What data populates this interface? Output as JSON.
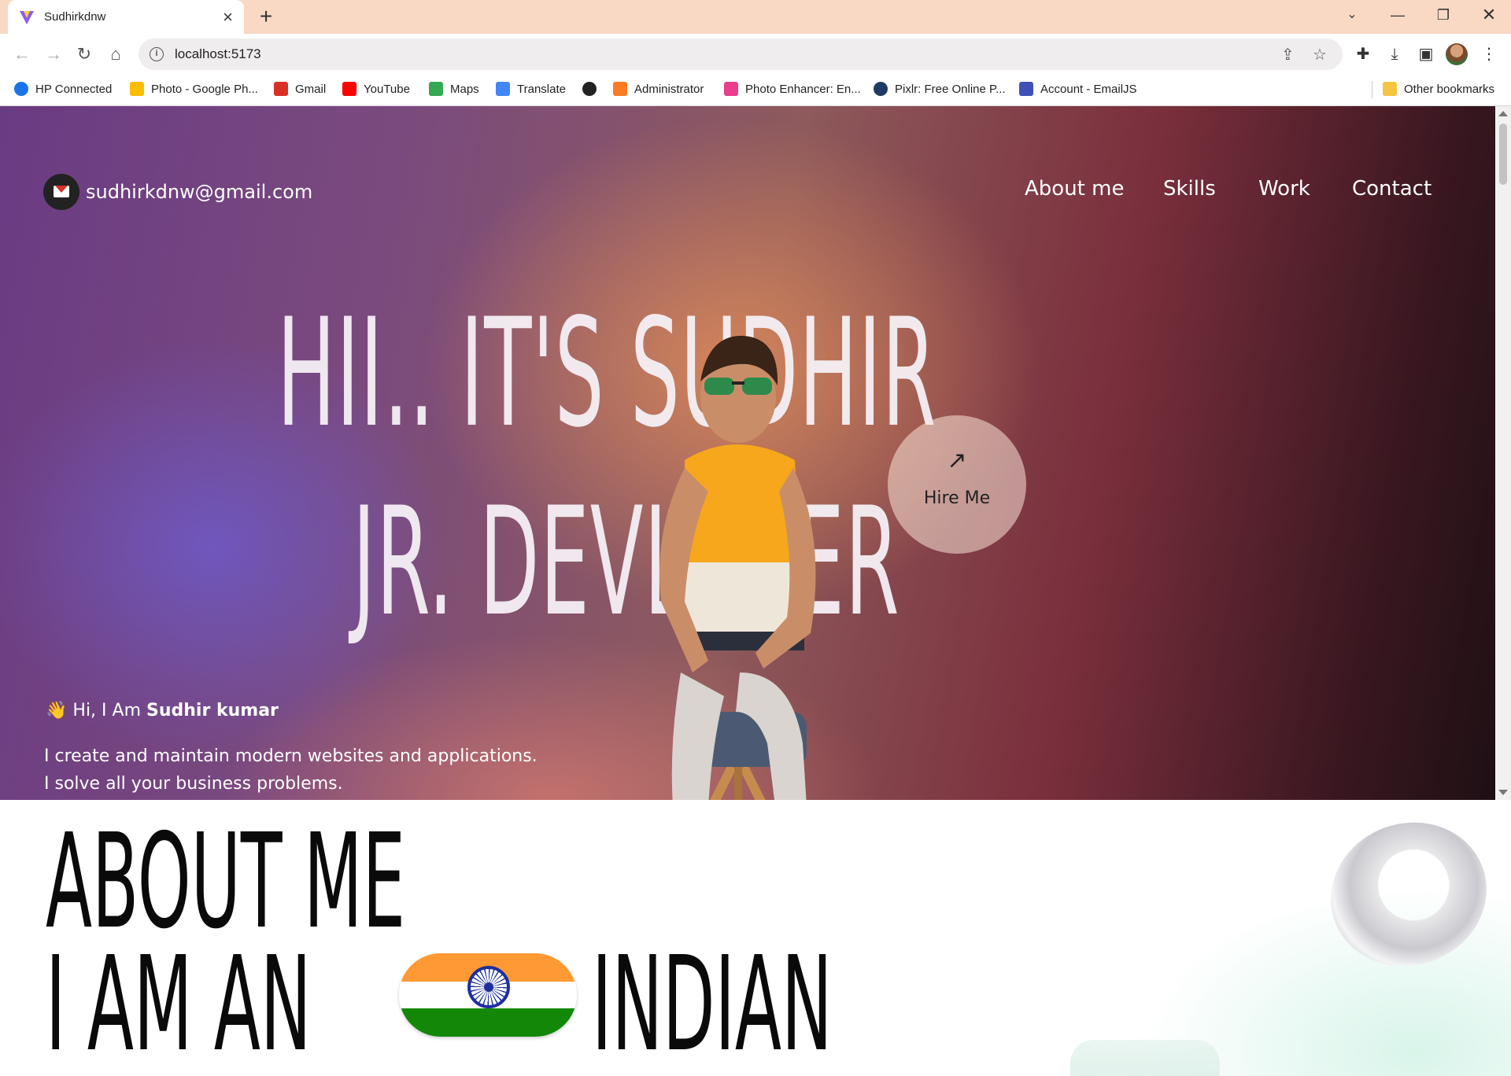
{
  "browser": {
    "tab_title": "Sudhirkdnw",
    "url": "localhost:5173",
    "bookmarks": [
      {
        "label": "HP Connected",
        "icon": "hp-icon",
        "color": "#1a73e8"
      },
      {
        "label": "Photo - Google Ph...",
        "icon": "google-photos-icon",
        "color": "#fbbc05"
      },
      {
        "label": "Gmail",
        "icon": "gmail-icon",
        "color": "#d93025"
      },
      {
        "label": "YouTube",
        "icon": "youtube-icon",
        "color": "#ff0000"
      },
      {
        "label": "Maps",
        "icon": "maps-icon",
        "color": "#34a853"
      },
      {
        "label": "Translate",
        "icon": "translate-icon",
        "color": "#4285f4"
      },
      {
        "label": "",
        "icon": "globe-icon",
        "color": "#222222"
      },
      {
        "label": "Administrator",
        "icon": "xampp-icon",
        "color": "#fb7a24"
      },
      {
        "label": "Photo Enhancer: En...",
        "icon": "photo-enhancer-icon",
        "color": "#e83e8c"
      },
      {
        "label": "Pixlr: Free Online P...",
        "icon": "pixlr-icon",
        "color": "#1f3a64"
      },
      {
        "label": "Account - EmailJS",
        "icon": "emailjs-icon",
        "color": "#3f51b5"
      }
    ],
    "other_bookmarks": "Other bookmarks"
  },
  "hero": {
    "email": "sudhirkdnw@gmail.com",
    "nav": [
      "About me",
      "Skills",
      "Work",
      "Contact"
    ],
    "headline_line1": "HII.. IT'S SUDHIR",
    "headline_line2": "JR. DEVLOPER",
    "hire_label": "Hire Me",
    "hire_arrow": "↗",
    "wave": "👋",
    "intro_prefix": "Hi, I Am",
    "intro_name": "Sudhir kumar",
    "tagline1": "I create and maintain modern websites and applications.",
    "tagline2": "I solve all your business problems."
  },
  "about": {
    "title": "ABOUT ME",
    "line2_prefix": "I AM AN",
    "line2_suffix": "INDIAN"
  },
  "colors": {
    "tab_strip": "#f9d9c4",
    "flag_saffron": "#ff9933",
    "flag_green": "#138808",
    "flag_chakra": "#1d2f9e"
  }
}
